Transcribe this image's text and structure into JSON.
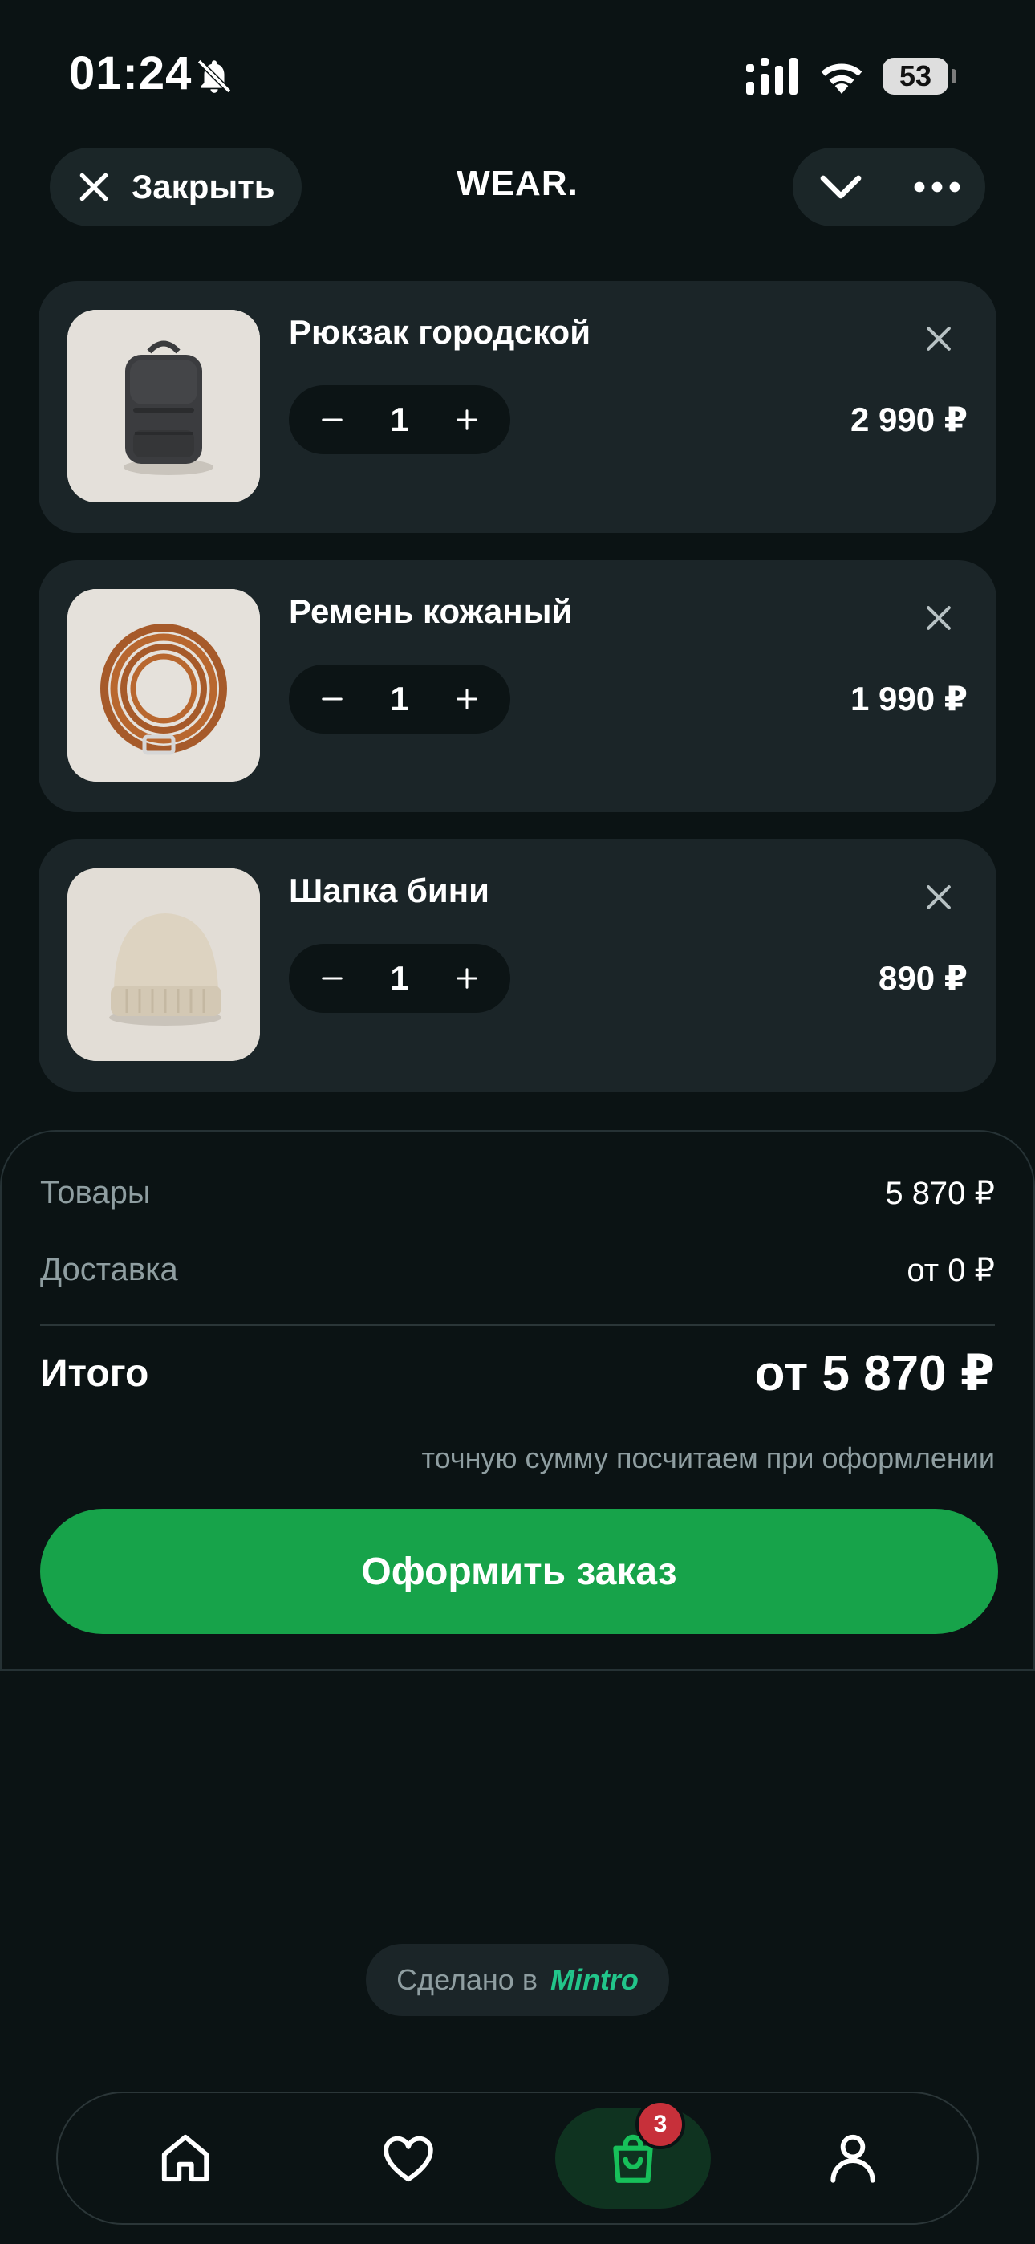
{
  "status_bar": {
    "time": "01:24",
    "battery": "53"
  },
  "header": {
    "close_label": "Закрыть",
    "title": "WEAR."
  },
  "cart": {
    "items": [
      {
        "name": "Рюкзак городской",
        "quantity": "1",
        "price": "2 990 ₽"
      },
      {
        "name": "Ремень кожаный",
        "quantity": "1",
        "price": "1 990 ₽"
      },
      {
        "name": "Шапка бини",
        "quantity": "1",
        "price": "890 ₽"
      }
    ]
  },
  "summary": {
    "goods_label": "Товары",
    "goods_value": "5 870 ₽",
    "delivery_label": "Доставка",
    "delivery_value": "от 0 ₽",
    "total_label": "Итого",
    "total_value": "от 5 870 ₽",
    "note": "точную сумму посчитаем при оформлении",
    "checkout_label": "Оформить заказ"
  },
  "footer": {
    "made_in": "Сделано в",
    "brand": "Mintro"
  },
  "nav": {
    "cart_badge": "3",
    "active": "cart"
  },
  "colors": {
    "background": "#0b1314",
    "card": "#1b2528",
    "accent": "#17a34a",
    "badge": "#c7303a",
    "brand": "#22c58a"
  }
}
